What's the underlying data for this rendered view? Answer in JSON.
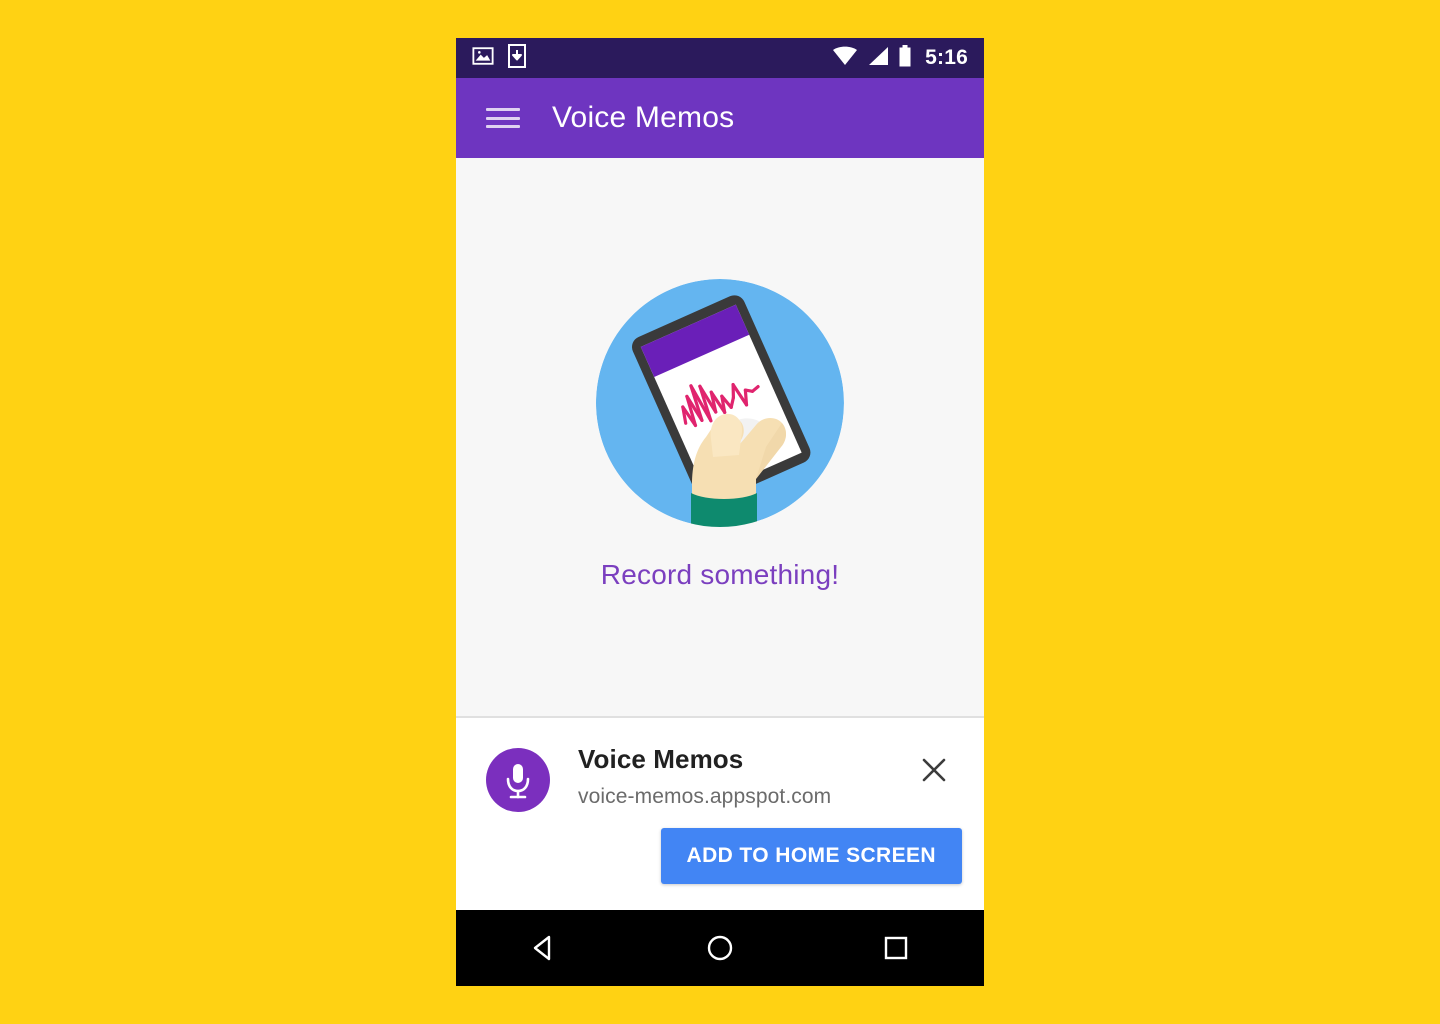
{
  "page": {
    "background_color": "#FFD213"
  },
  "status_bar": {
    "background_color": "#2B1A5C",
    "time": "5:16",
    "left_icons": [
      "image-icon",
      "download-to-device-icon"
    ],
    "right_icons": [
      "wifi-icon",
      "cellular-signal-icon",
      "battery-icon"
    ]
  },
  "app_bar": {
    "background_color": "#6E35C0",
    "menu_icon": "hamburger-menu-icon",
    "title": "Voice Memos"
  },
  "content": {
    "background_color": "#F7F7F7",
    "illustration": {
      "name": "hand-holding-phone-recording-illustration",
      "circle_color": "#64B5F0",
      "phone_bezel_color": "#3A3A3A",
      "phone_screen_color": "#FFFFFF",
      "phone_appbar_color": "#6A1FB8",
      "waveform_color": "#E0246E",
      "skin_color": "#F6DFB3",
      "sleeve_color": "#0E8A6E"
    },
    "empty_state_text": "Record something!",
    "empty_state_color": "#7B3FBF"
  },
  "install_banner": {
    "background_color": "#FFFFFF",
    "app_icon": {
      "name": "microphone-icon",
      "circle_color": "#7B2FBE",
      "glyph_color": "#FFFFFF"
    },
    "title": "Voice Memos",
    "url": "voice-memos.appspot.com",
    "close_icon": "close-icon",
    "install_button_label": "ADD TO HOME SCREEN",
    "install_button_color": "#4285F4"
  },
  "nav_bar": {
    "background_color": "#000000",
    "buttons": [
      {
        "name": "back-button",
        "icon": "back-triangle-icon"
      },
      {
        "name": "home-button",
        "icon": "home-circle-icon"
      },
      {
        "name": "recents-button",
        "icon": "recents-square-icon"
      }
    ]
  }
}
